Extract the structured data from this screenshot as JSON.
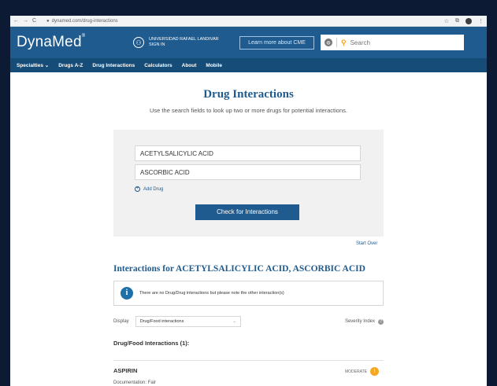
{
  "browser": {
    "nav": [
      "←",
      "→",
      "C"
    ],
    "url": "dynamed.com/drug-interactions",
    "icons": [
      "star-icon",
      "extension-icon",
      "profile-icon",
      "menu-icon"
    ]
  },
  "header": {
    "logo": "DynaMed",
    "institution_line1": "UNIVERSIDAD RAFAEL LANDIVAR",
    "institution_line2": "SIGN IN",
    "cme_button": "Learn more about CME",
    "search_placeholder": "Search"
  },
  "nav": {
    "items": [
      "Specialties ⌄",
      "Drugs A-Z",
      "Drug Interactions",
      "Calculators",
      "About",
      "Mobile"
    ]
  },
  "main": {
    "title": "Drug Interactions",
    "subtitle": "Use the search fields to look up two or more drugs for potential interactions.",
    "drug1": "ACETYLSALICYLIC ACID",
    "drug2": "ASCORBIC ACID",
    "add_drug": "Add Drug",
    "check_button": "Check for Interactions",
    "start_over": "Start Over",
    "results_title": "Interactions for ACETYLSALICYLIC ACID, ASCORBIC ACID",
    "notice": "There are no Drug/Drug interactions but please note the other interaction(s)",
    "display_label": "Display",
    "display_value": "Drug/Food interactions",
    "severity_label": "Severity Index",
    "section_head": "Drug/Food Interactions (1):",
    "drug_name": "ASPIRIN",
    "severity_value": "MODERATE",
    "documentation": "Documentation: Fair"
  },
  "colors": {
    "header": "#1f5b8e",
    "nav": "#164c78",
    "accent": "#f5a623"
  }
}
